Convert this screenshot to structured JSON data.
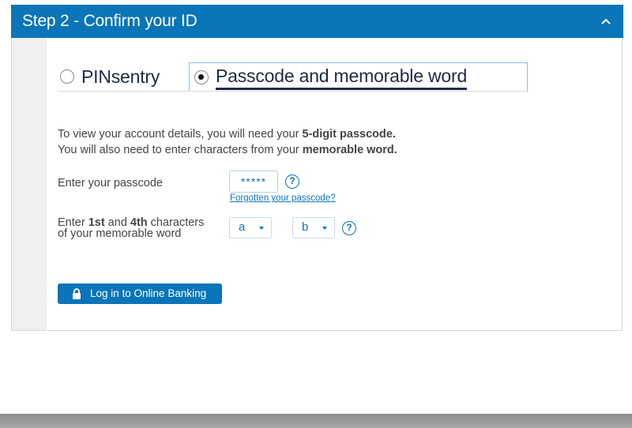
{
  "header": {
    "title": "Step 2 - Confirm your ID",
    "collapse_icon": "chevron-up-icon",
    "color": "#0a75b8"
  },
  "auth_options": {
    "pinsentry_label": "PINsentry",
    "passcode_label": "Passcode and memorable word",
    "selected": "Passcode and memorable word"
  },
  "intro": {
    "line1_prefix": "To view your account details, you will need your ",
    "line1_bold": "5-digit passcode.",
    "line2_prefix": "You will also need to enter characters from your ",
    "line2_bold": "memorable word."
  },
  "passcode": {
    "label": "Enter your passcode",
    "value": "*****",
    "forgot_link": "Forgotten your passcode?",
    "help_icon": "question-circle-icon"
  },
  "memorable_word": {
    "label_prefix": "Enter ",
    "label_first": "1st",
    "label_and": " and ",
    "label_second": "4th",
    "label_suffix": " characters",
    "label_line2": "of your memorable word",
    "select1_value": "a",
    "select2_value": "b",
    "help_icon": "question-circle-icon"
  },
  "login_button": {
    "label": "Log in to Online Banking",
    "icon": "lock-icon"
  }
}
